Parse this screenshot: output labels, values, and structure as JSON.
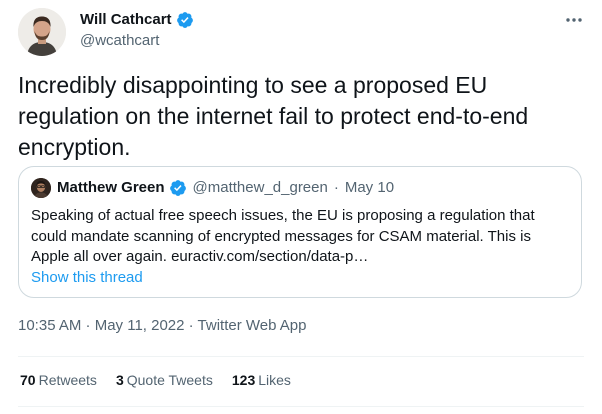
{
  "tweet": {
    "author": {
      "name": "Will Cathcart",
      "handle": "@wcathcart",
      "verified": true
    },
    "text": "Incredibly disappointing to see a proposed EU regulation on the internet fail to protect end-to-end encryption.",
    "quoted": {
      "author_name": "Matthew Green",
      "verified": true,
      "handle": "@matthew_d_green",
      "date": "May 10",
      "text": "Speaking of actual free speech issues, the EU is proposing a regulation that could mandate scanning of encrypted messages for CSAM material. This is Apple all over again. euractiv.com/section/data-p…",
      "show_thread_label": "Show this thread"
    },
    "timestamp": "10:35 AM · May 11, 2022 · Twitter Web App",
    "stats": {
      "retweets": {
        "count": "70",
        "label": "Retweets"
      },
      "quote_tweets": {
        "count": "3",
        "label": "Quote Tweets"
      },
      "likes": {
        "count": "123",
        "label": "Likes"
      }
    }
  },
  "icons": {
    "verified": "verified-badge-icon",
    "more": "more-horizontal-icon"
  },
  "colors": {
    "text_primary": "#0f1419",
    "text_secondary": "#536471",
    "accent": "#1d9bf0",
    "border": "#cfd9de",
    "divider": "#eff3f4"
  }
}
